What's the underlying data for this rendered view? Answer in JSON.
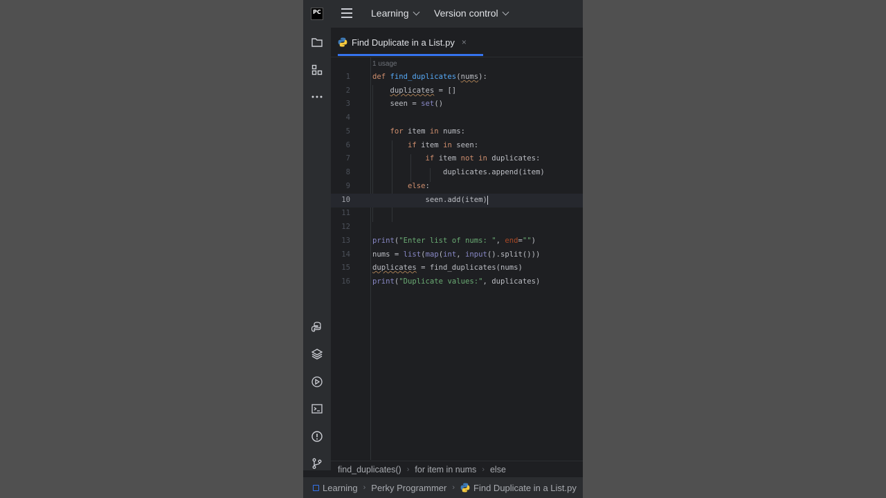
{
  "toolbar": {
    "logo_text": "PC",
    "menu_project": "Learning",
    "menu_vcs": "Version control"
  },
  "tab": {
    "filename": "Find Duplicate in a List.py",
    "close": "×"
  },
  "editor": {
    "usage_hint": "1 usage",
    "current_line": 10,
    "line_numbers": [
      "1",
      "2",
      "3",
      "4",
      "5",
      "6",
      "7",
      "8",
      "9",
      "10",
      "11",
      "12",
      "13",
      "14",
      "15",
      "16"
    ]
  },
  "breadcrumb": {
    "items": [
      "find_duplicates()",
      "for item in nums",
      "else"
    ],
    "sep": "›"
  },
  "statusbar": {
    "items": [
      "Learning",
      "Perky Programmer",
      "Find Duplicate in a List.py"
    ],
    "sep": "›"
  },
  "icons": {
    "strip_top": [
      "folder-icon",
      "structure-icon",
      "more-icon"
    ],
    "strip_bottom": [
      "python-console-icon",
      "layers-icon",
      "run-icon",
      "terminal-icon",
      "problems-icon",
      "git-icon"
    ]
  },
  "colors": {
    "accent": "#3574f0",
    "keyword": "#cf8e6d",
    "string": "#6aab73",
    "function": "#56a8f5",
    "builtin": "#8888c6"
  }
}
